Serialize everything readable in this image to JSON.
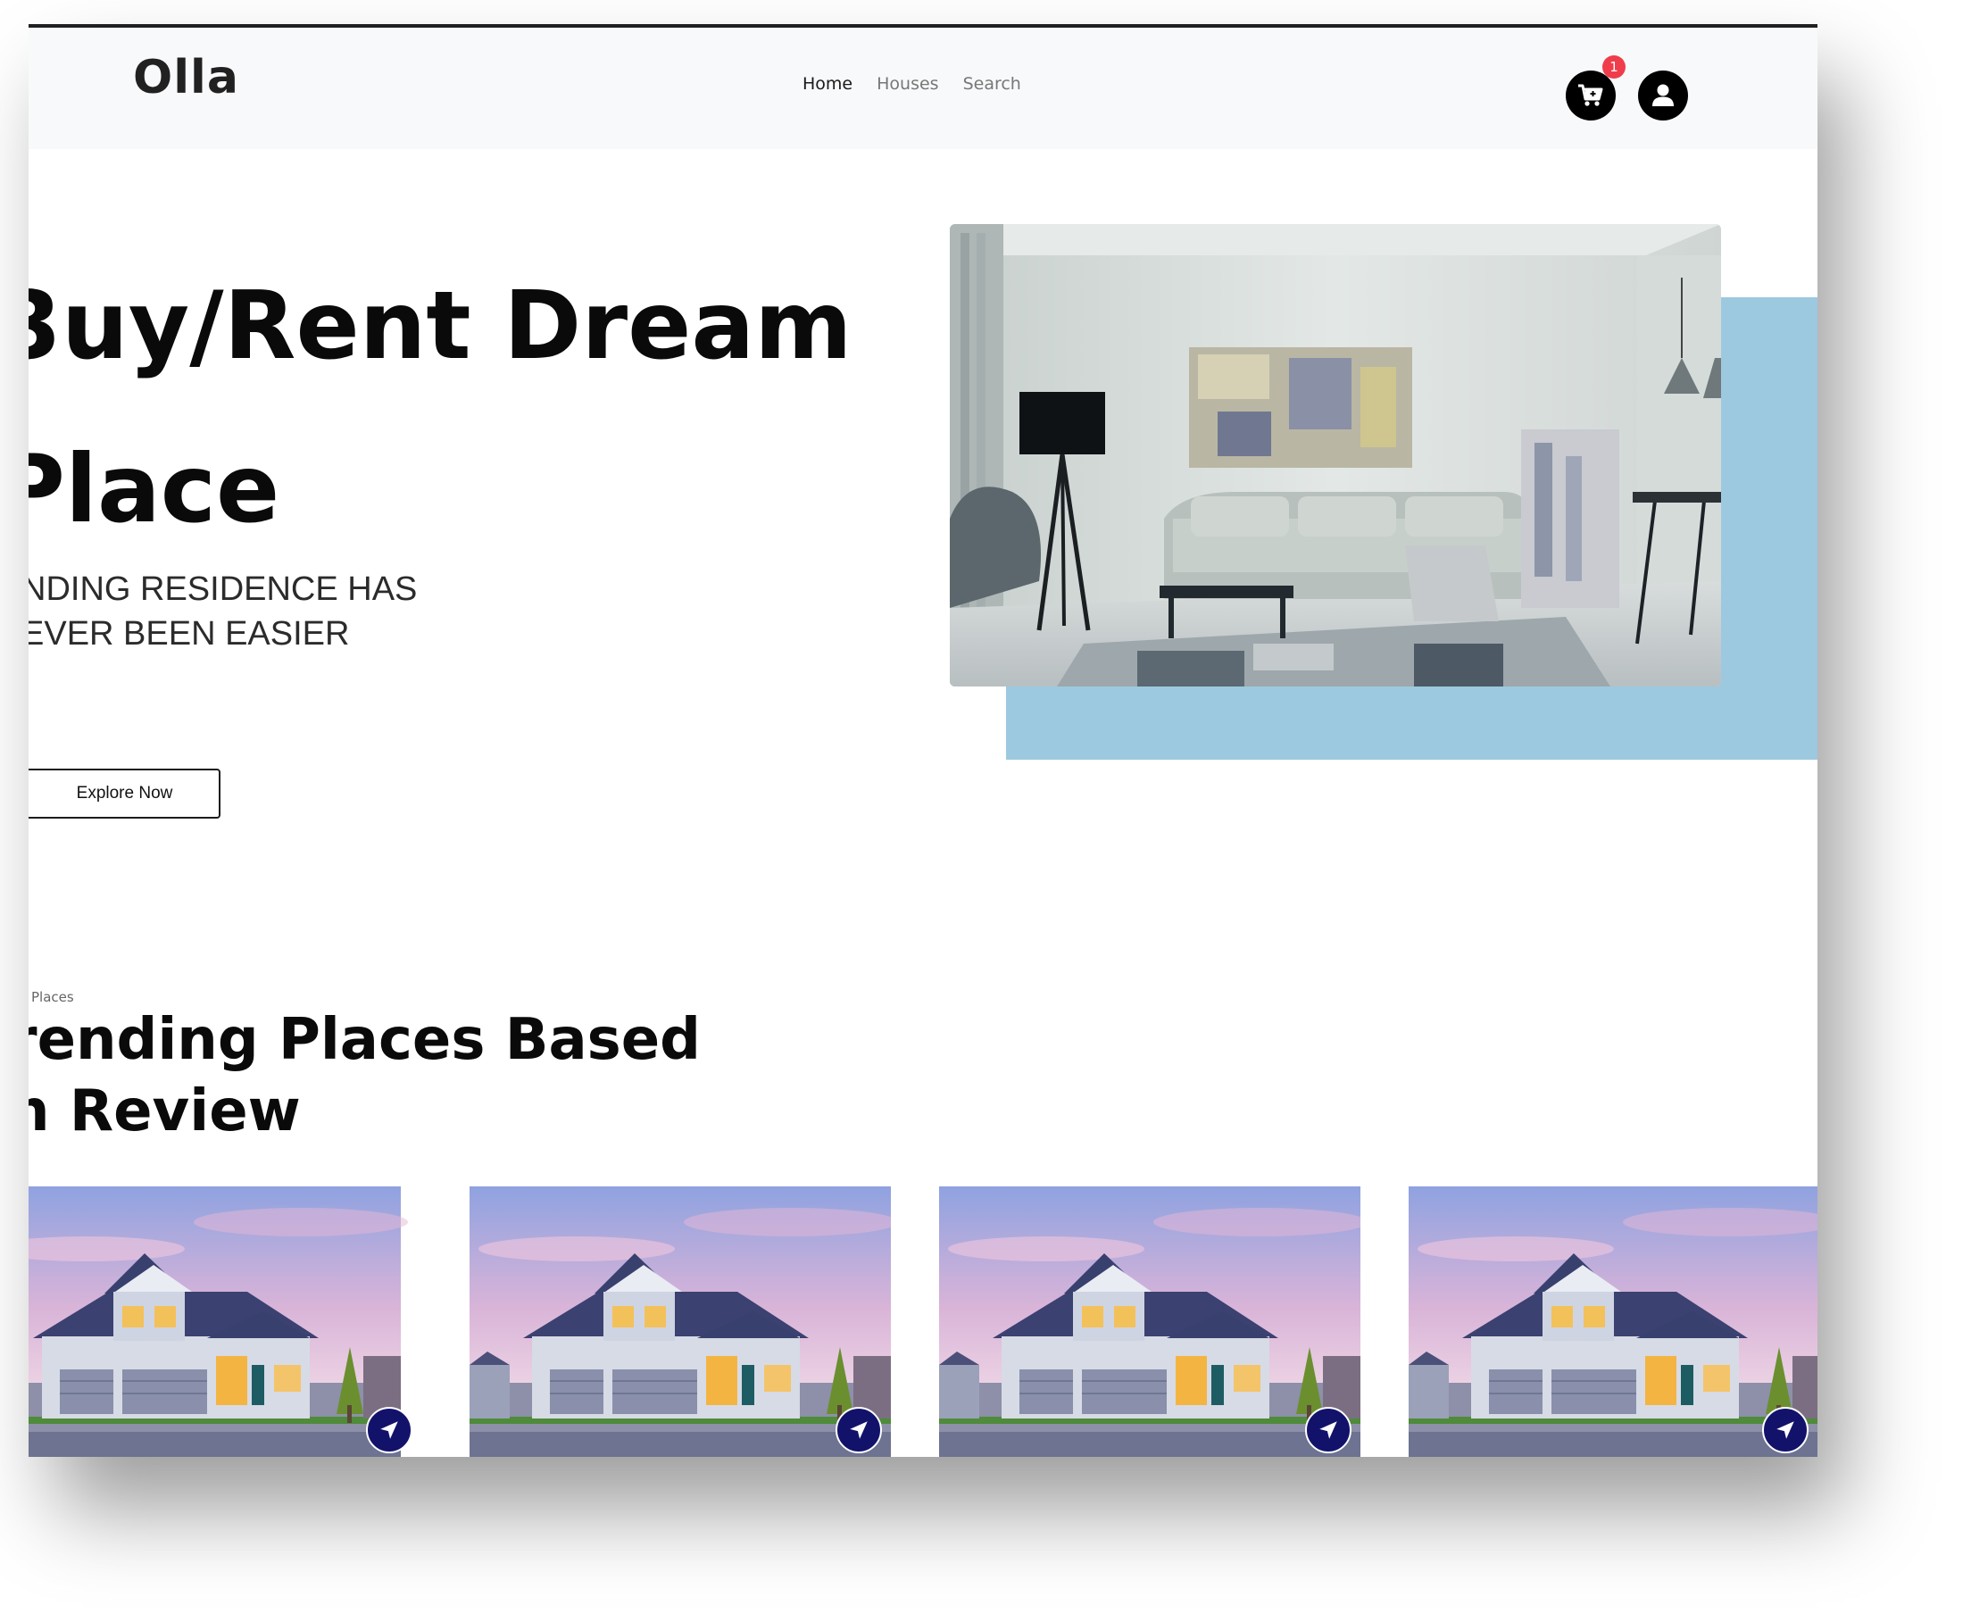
{
  "brand": {
    "logo": "Olla"
  },
  "nav": {
    "items": [
      {
        "label": "Home",
        "active": true
      },
      {
        "label": "Houses",
        "active": false
      },
      {
        "label": "Search",
        "active": false
      }
    ]
  },
  "header_icons": {
    "cart_icon": "shopping-cart-icon",
    "cart_badge": "1",
    "user_icon": "user-circle-icon"
  },
  "hero": {
    "title": "3uy/Rent Dream\nPlace",
    "subtitle": "NDING RESIDENCE HAS\nEVER BEEN EASIER",
    "cta_label": "Explore Now",
    "image": "living-room-photo"
  },
  "trending": {
    "label": "Places",
    "title": "rending Places Based\nn Review",
    "cards": [
      {
        "image": "house-photo",
        "action_icon": "navigation-arrow-icon"
      },
      {
        "image": "house-photo",
        "action_icon": "navigation-arrow-icon"
      },
      {
        "image": "house-photo",
        "action_icon": "navigation-arrow-icon"
      },
      {
        "image": "house-photo",
        "action_icon": "navigation-arrow-icon"
      }
    ]
  },
  "colors": {
    "backdrop": "#9cc9df",
    "badge": "#ef3d4b",
    "nav_circle": "#13126b",
    "navbar_bg": "#f8f9fa"
  }
}
